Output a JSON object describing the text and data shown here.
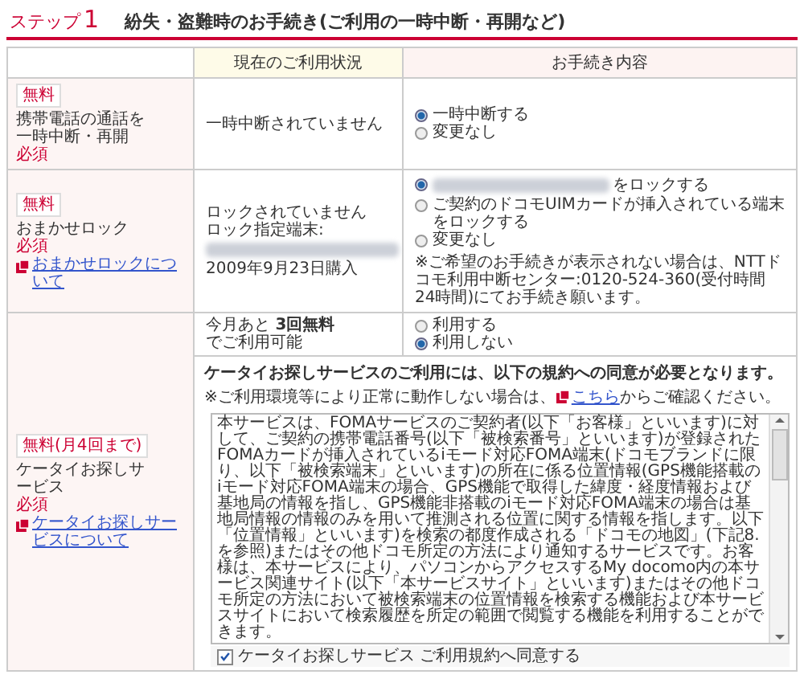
{
  "step": {
    "label": "ステップ",
    "number": "1",
    "title": "紛失・盗難時のお手続き(ご利用の一時中断・再開など)"
  },
  "table": {
    "columns": [
      "現在のご利用状況",
      "お手続き内容"
    ],
    "rows": [
      {
        "badge": "無料",
        "name": "携帯電話の通話を一時中断・再開",
        "required": "必須",
        "status": [
          {
            "kind": "text",
            "text": "一時中断されていません"
          }
        ],
        "options": [
          {
            "label": "一時中断する",
            "selected": true
          },
          {
            "label": "変更なし",
            "selected": false
          }
        ]
      },
      {
        "badge": "無料",
        "name": "おまかせロック",
        "required": "必須",
        "link": "おまかせロックについて",
        "status": [
          {
            "kind": "text",
            "text": "ロックされていません"
          },
          {
            "kind": "text",
            "text": "ロック指定端末:"
          },
          {
            "kind": "redacted"
          },
          {
            "kind": "text",
            "text": "2009年9月23日購入"
          }
        ],
        "options": [
          {
            "label": "をロックする",
            "redacted_prefix": true,
            "selected": true
          },
          {
            "label": "ご契約のドコモUIMカードが挿入されている端末をロックする",
            "selected": false
          },
          {
            "label": "変更なし",
            "selected": false
          }
        ],
        "note": "※ご希望のお手続きが表示されない場合は、NTTドコモ利用中断センター:0120-524-360(受付時間24時間)にてお手続き願います。"
      },
      {
        "badge": "無料(月4回まで)",
        "name": "ケータイお探しサービス",
        "required": "必須",
        "link": "ケータイお探しサービスについて",
        "status": [
          {
            "kind": "text",
            "text": "今月あと **3回無料**"
          },
          {
            "kind": "text",
            "text": "でご利用可能"
          }
        ],
        "options": [
          {
            "label": "利用する",
            "selected": false
          },
          {
            "label": "利用しない",
            "selected": true
          }
        ],
        "agreement": {
          "heading": "ケータイお探しサービスのご利用には、以下の規約への同意が必要となります。",
          "note_before": "※ご利用環境等により正常に動作しない場合は、",
          "note_link": "こちら",
          "note_after": "からご確認ください。",
          "terms": "本サービスは、FOMAサービスのご契約者(以下「お客様」といいます)に対して、ご契約の携帯電話番号(以下「被検索番号」といいます)が登録されたFOMAカードが挿入されているiモード対応FOMA端末(ドコモブランドに限り、以下「被検索端末」といいます)の所在に係る位置情報(GPS機能搭載のiモード対応FOMA端末の場合、GPS機能で取得した緯度・経度情報および基地局の情報を指し、GPS機能非搭載のiモード対応FOMA端末の場合は基地局情報の情報のみを用いて推測される位置に関する情報を指します。以下「位置情報」といいます)を検索の都度作成される「ドコモの地図」(下記8.を参照)またはその他ドコモ所定の方法により通知するサービスです。お客様は、本サービスにより、パソコンからアクセスするMy docomo内の本サービス関連サイト(以下「本サービスサイト」といいます)またはその他ドコモ所定の方法において被検索端末の位置情報を検索する機能および本サービスサイトにおいて検索履歴を所定の範囲で閲覧する機能を利用することができます。",
          "checkbox_label": "ケータイお探しサービス ご利用規約へ同意する",
          "checked": true
        }
      }
    ]
  }
}
